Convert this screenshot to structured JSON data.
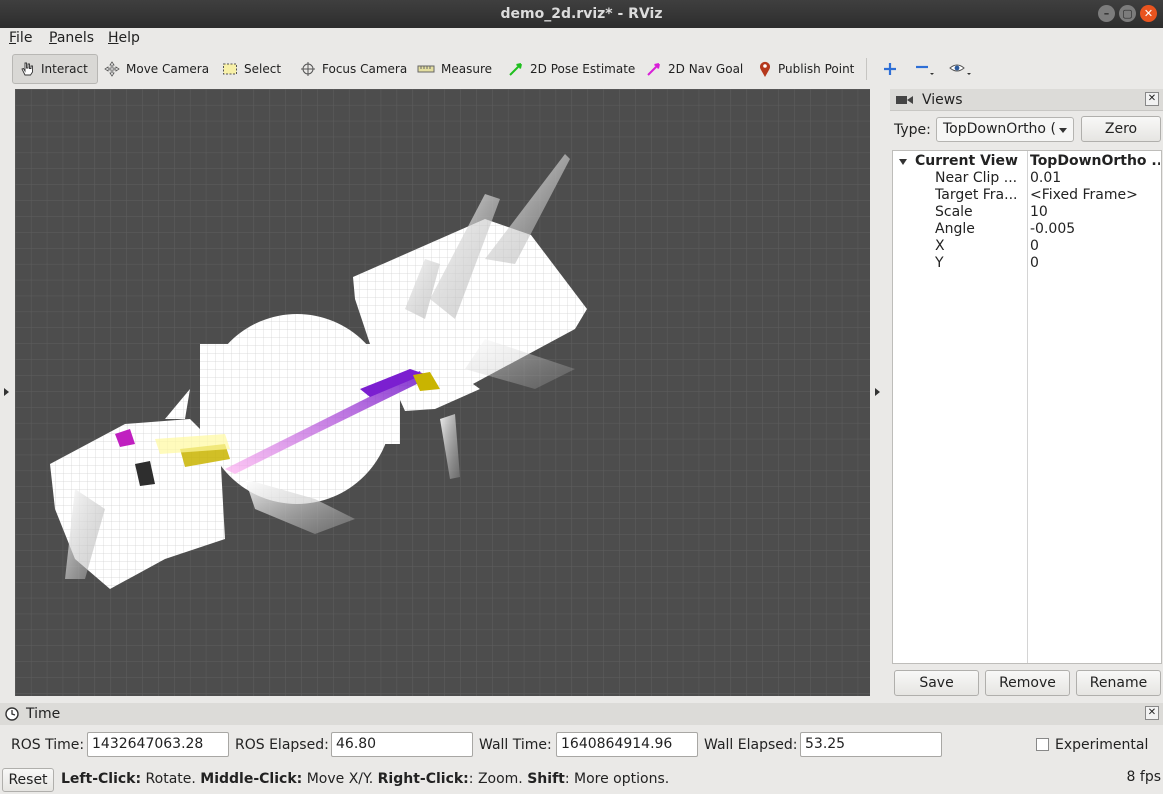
{
  "window": {
    "title": "demo_2d.rviz* - RViz",
    "buttons": [
      "–",
      "▢",
      "✕"
    ]
  },
  "menu": [
    {
      "label": "File",
      "mnemonic": "F",
      "rest": "ile"
    },
    {
      "label": "Panels",
      "mnemonic": "P",
      "rest": "anels"
    },
    {
      "label": "Help",
      "mnemonic": "H",
      "rest": "elp"
    }
  ],
  "toolbar": {
    "interact": "Interact",
    "move_camera": "Move Camera",
    "select": "Select",
    "focus_camera": "Focus Camera",
    "measure": "Measure",
    "pose_estimate": "2D Pose Estimate",
    "nav_goal": "2D Nav Goal",
    "publish_point": "Publish Point"
  },
  "views": {
    "title": "Views",
    "type_label": "Type:",
    "type_value": "TopDownOrtho (",
    "zero_button": "Zero",
    "rows": [
      {
        "key": "Current View",
        "value": "TopDownOrtho ..."
      },
      {
        "key": "Near Clip ...",
        "value": "0.01"
      },
      {
        "key": "Target Fra...",
        "value": "<Fixed Frame>"
      },
      {
        "key": "Scale",
        "value": "10"
      },
      {
        "key": "Angle",
        "value": "-0.005"
      },
      {
        "key": "X",
        "value": "0"
      },
      {
        "key": "Y",
        "value": "0"
      }
    ],
    "save": "Save",
    "remove": "Remove",
    "rename": "Rename"
  },
  "time": {
    "title": "Time",
    "ros_time_label": "ROS Time:",
    "ros_time": "1432647063.28",
    "ros_elapsed_label": "ROS Elapsed:",
    "ros_elapsed": "46.80",
    "wall_time_label": "Wall Time:",
    "wall_time": "1640864914.96",
    "wall_elapsed_label": "Wall Elapsed:",
    "wall_elapsed": "53.25",
    "experimental_label": "Experimental",
    "experimental_checked": false
  },
  "status": {
    "reset": "Reset",
    "left_click": "Left-Click:",
    "left_action": " Rotate. ",
    "middle_click": "Middle-Click:",
    "middle_action": " Move X/Y. ",
    "right_click": "Right-Click:",
    "right_action": ": Zoom. ",
    "shift": "Shift",
    "shift_action": ": More options.",
    "fps": "8 fps"
  },
  "colors": {
    "grid_bg": "#4d4d4d",
    "grid_line": "#5e5e5e",
    "map_free": "#ffffff",
    "laser_purple": "#7b1fd0",
    "laser_yellow": "#c9b400",
    "path_magenta": "#ff40e0",
    "close_button": "#e9541f"
  },
  "icons": [
    "hand-pointer-icon",
    "move-camera-icon",
    "select-box-icon",
    "focus-camera-icon",
    "measure-ruler-icon",
    "pose-estimate-arrow-icon",
    "nav-goal-arrow-icon",
    "map-pin-icon",
    "plus-icon",
    "minus-icon",
    "eye-icon",
    "camera-icon",
    "clock-icon"
  ]
}
